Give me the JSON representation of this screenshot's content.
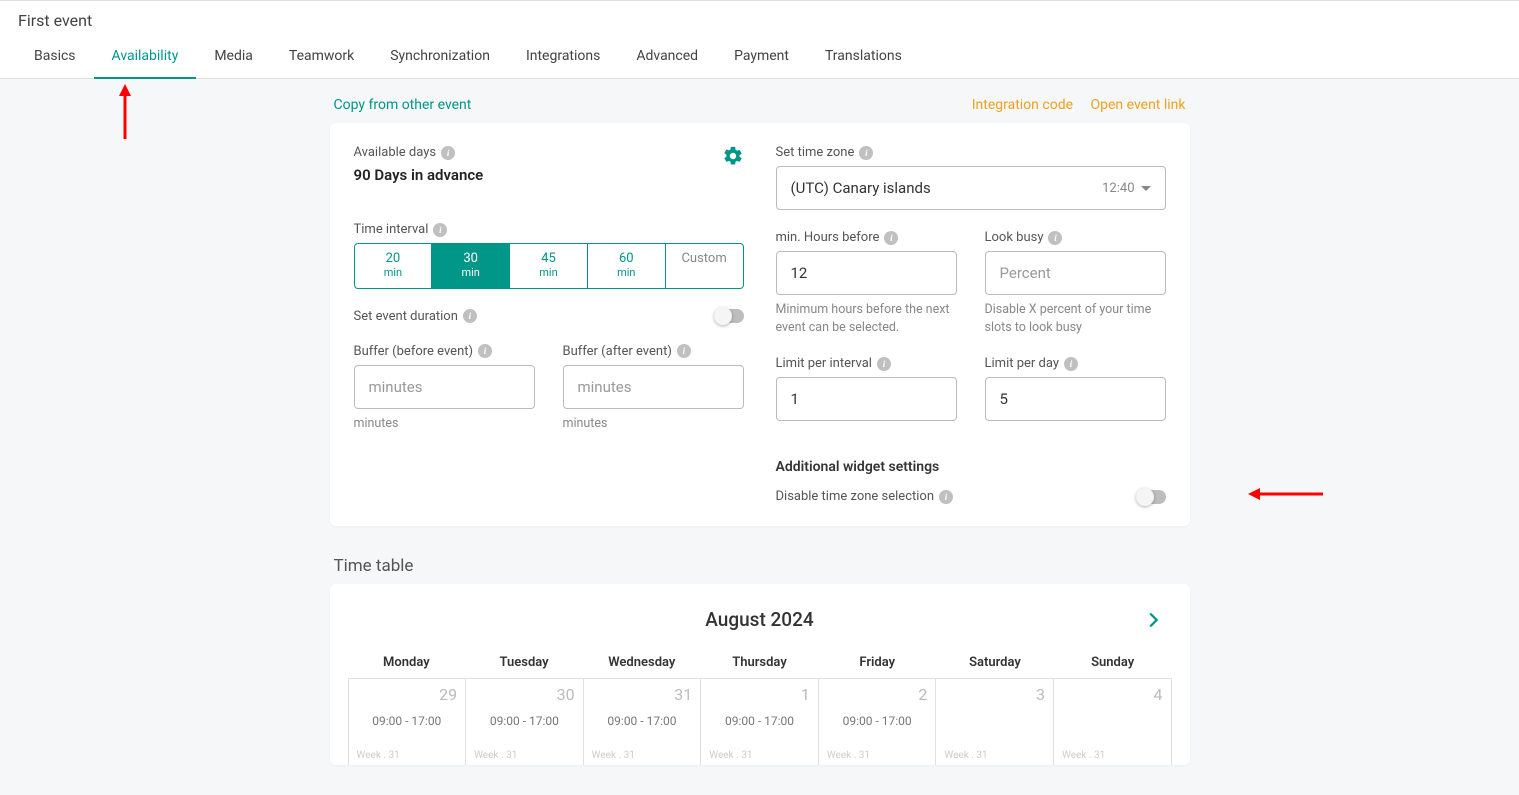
{
  "header": {
    "title": "First event",
    "tabs": [
      "Basics",
      "Availability",
      "Media",
      "Teamwork",
      "Synchronization",
      "Integrations",
      "Advanced",
      "Payment",
      "Translations"
    ],
    "active_tab_index": 1
  },
  "links": {
    "copy_from": "Copy from other event",
    "integration_code": "Integration code",
    "open_event": "Open event link"
  },
  "left": {
    "available_days_label": "Available days",
    "available_days_value": "90 Days in advance",
    "time_interval_label": "Time interval",
    "intervals": [
      {
        "value": "20",
        "unit": "min",
        "selected": false
      },
      {
        "value": "30",
        "unit": "min",
        "selected": true
      },
      {
        "value": "45",
        "unit": "min",
        "selected": false
      },
      {
        "value": "60",
        "unit": "min",
        "selected": false
      }
    ],
    "interval_custom": "Custom",
    "set_duration_label": "Set event duration",
    "buffer_before_label": "Buffer (before event)",
    "buffer_after_label": "Buffer (after event)",
    "buffer_before_value": "",
    "buffer_after_value": "",
    "buffer_placeholder": "minutes",
    "buffer_hint": "minutes"
  },
  "right": {
    "timezone_label": "Set time zone",
    "timezone_value": "(UTC) Canary islands",
    "timezone_time": "12:40",
    "min_hours_label": "min. Hours before",
    "min_hours_value": "12",
    "min_hours_hint": "Minimum hours before the next event can be selected.",
    "look_busy_label": "Look busy",
    "look_busy_value": "",
    "look_busy_placeholder": "Percent",
    "look_busy_hint": "Disable X percent of your time slots to look busy",
    "limit_interval_label": "Limit per interval",
    "limit_interval_value": "1",
    "limit_day_label": "Limit per day",
    "limit_day_value": "5",
    "additional_label": "Additional widget settings",
    "disable_tz_label": "Disable time zone selection"
  },
  "timetable": {
    "section_title": "Time table",
    "month": "August 2024",
    "dow": [
      "Monday",
      "Tuesday",
      "Wednesday",
      "Thursday",
      "Friday",
      "Saturday",
      "Sunday"
    ],
    "cells": [
      {
        "num": "29",
        "time": "09:00 - 17:00",
        "week": "Week . 31"
      },
      {
        "num": "30",
        "time": "09:00 - 17:00",
        "week": "Week . 31"
      },
      {
        "num": "31",
        "time": "09:00 - 17:00",
        "week": "Week . 31"
      },
      {
        "num": "1",
        "time": "09:00 - 17:00",
        "week": "Week . 31"
      },
      {
        "num": "2",
        "time": "09:00 - 17:00",
        "week": "Week . 31"
      },
      {
        "num": "3",
        "time": "",
        "week": "Week . 31"
      },
      {
        "num": "4",
        "time": "",
        "week": "Week . 31"
      }
    ]
  }
}
